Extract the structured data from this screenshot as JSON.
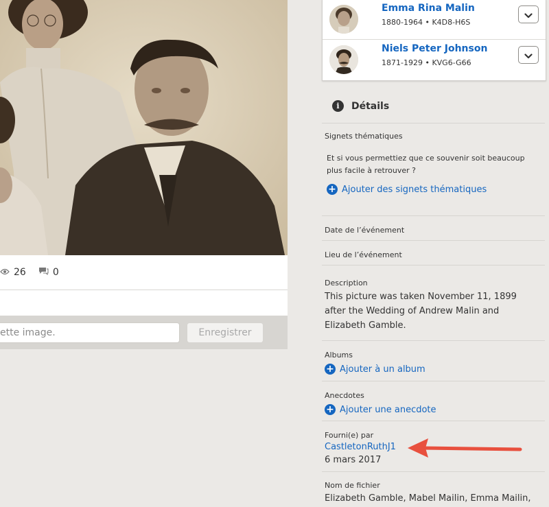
{
  "photo": {
    "views_count": "26",
    "comments_count": "0"
  },
  "caption": {
    "placeholder": "ette image.",
    "save_label": "Enregistrer"
  },
  "persons": [
    {
      "name": "Emma Rina Malin",
      "meta": "1880-1964 • K4D8-H6S"
    },
    {
      "name": "Niels Peter Johnson",
      "meta": "1871-1929 • KVG6-G66"
    }
  ],
  "details": {
    "title": "Détails",
    "topic_tags": {
      "label": "Signets thématiques",
      "prompt": "Et si vous permettiez que ce souvenir soit beaucoup plus facile à retrouver ?",
      "add_label": "Ajouter des signets thématiques"
    },
    "event_date_label": "Date de l’événement",
    "event_place_label": "Lieu de l’événement",
    "description": {
      "label": "Description",
      "text": "This picture was taken November 11, 1899 after the Wedding of Andrew Malin and Elizabeth Gamble."
    },
    "albums": {
      "label": "Albums",
      "add_label": "Ajouter à un album"
    },
    "anecdotes": {
      "label": "Anecdotes",
      "add_label": "Ajouter une anecdote"
    },
    "contributed": {
      "label": "Fourni(e) par",
      "user": "CastletonRuthJ1",
      "date": "6 mars 2017"
    },
    "filename": {
      "label": "Nom de fichier",
      "value": "Elizabeth Gamble, Mabel Mailin, Emma Mailin,"
    }
  },
  "colors": {
    "link": "#1566c0",
    "arrow": "#e8503e",
    "page_bg": "#ebe9e6"
  },
  "icons": [
    "eye-icon",
    "comment-icon",
    "chevron-down-icon",
    "info-icon",
    "plus-circle-icon",
    "arrow-icon"
  ]
}
